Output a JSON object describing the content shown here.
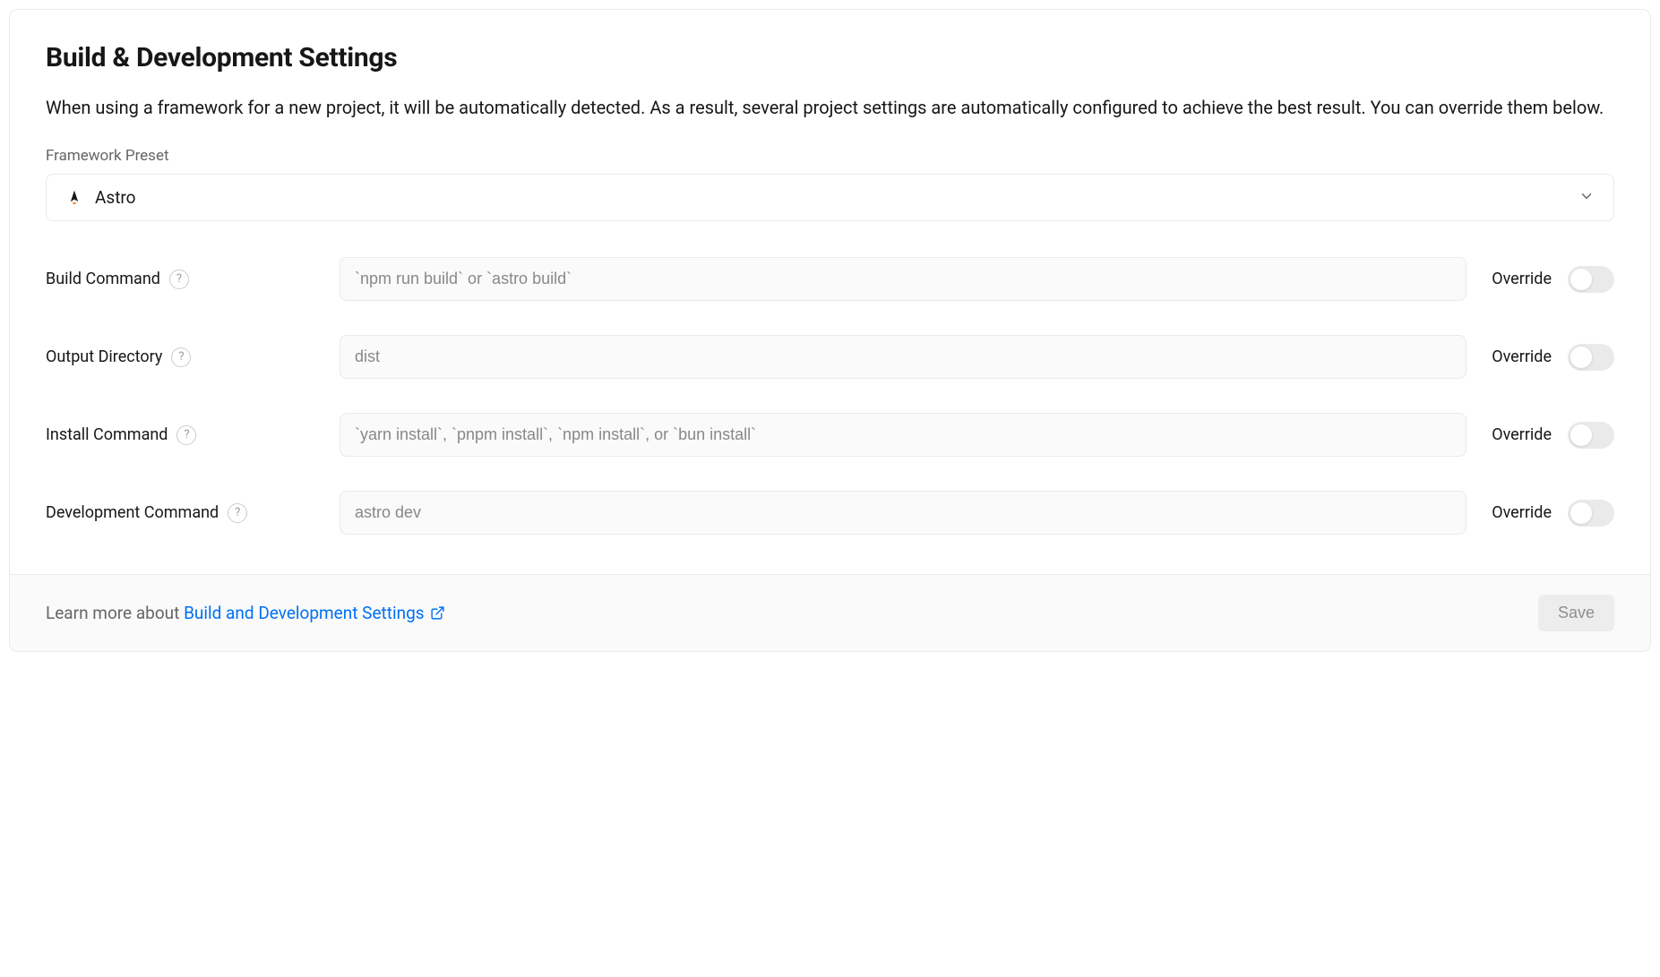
{
  "header": {
    "title": "Build & Development Settings",
    "description": "When using a framework for a new project, it will be automatically detected. As a result, several project settings are automatically configured to achieve the best result. You can override them below."
  },
  "framework": {
    "label": "Framework Preset",
    "selected": "Astro"
  },
  "rows": {
    "build": {
      "label": "Build Command",
      "placeholder": "`npm run build` or `astro build`",
      "override_label": "Override"
    },
    "output": {
      "label": "Output Directory",
      "placeholder": "dist",
      "override_label": "Override"
    },
    "install": {
      "label": "Install Command",
      "placeholder": "`yarn install`, `pnpm install`, `npm install`, or `bun install`",
      "override_label": "Override"
    },
    "dev": {
      "label": "Development Command",
      "placeholder": "astro dev",
      "override_label": "Override"
    }
  },
  "footer": {
    "prefix": "Learn more about ",
    "link_text": "Build and Development Settings",
    "save_label": "Save"
  }
}
